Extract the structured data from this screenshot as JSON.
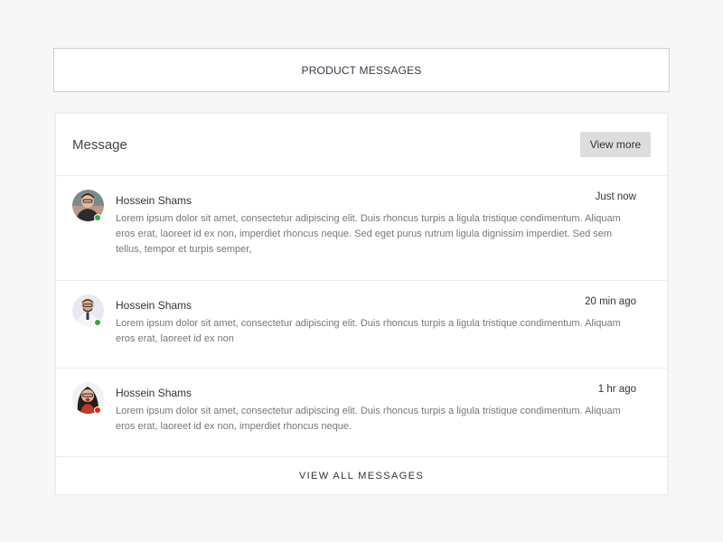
{
  "header": {
    "title": "PRODUCT MESSAGES"
  },
  "card": {
    "title": "Message",
    "view_more_label": "View more",
    "footer_label": "VIEW ALL MESSAGES"
  },
  "messages": [
    {
      "name": "Hossein Shams",
      "time": "Just now",
      "text": "Lorem ipsum dolor sit amet, consectetur adipiscing elit. Duis rhoncus turpis a ligula tristique condimentum. Aliquam eros erat, laoreet id ex non, imperdiet rhoncus neque. Sed eget purus rutrum ligula dignissim imperdiet. Sed sem tellus, tempor et turpis semper,",
      "status": "online",
      "status_color": "#2eaa3c"
    },
    {
      "name": "Hossein Shams",
      "time": "20 min ago",
      "text": "Lorem ipsum dolor sit amet, consectetur adipiscing elit. Duis rhoncus turpis a ligula tristique condimentum. Aliquam eros erat, laoreet id ex non",
      "status": "online",
      "status_color": "#2eaa3c"
    },
    {
      "name": "Hossein Shams",
      "time": "1 hr ago",
      "text": "Lorem ipsum dolor sit amet, consectetur adipiscing elit. Duis rhoncus turpis a ligula tristique condimentum. Aliquam eros erat, laoreet id ex non, imperdiet rhoncus neque.",
      "status": "busy",
      "status_color": "#e02020"
    }
  ],
  "colors": {
    "background": "#f7f7f7",
    "card": "#ffffff",
    "border": "#ececec",
    "button": "#dddddd",
    "online": "#2eaa3c",
    "busy": "#e02020"
  }
}
